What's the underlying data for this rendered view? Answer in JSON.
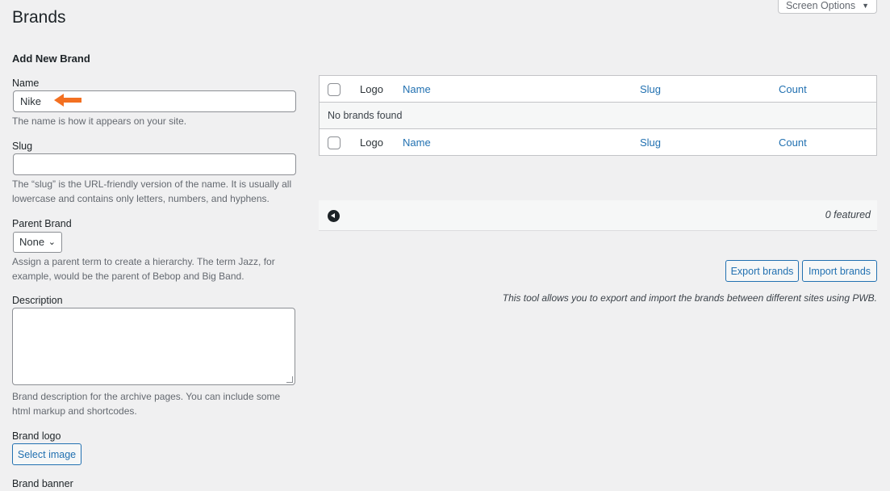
{
  "screen_options": {
    "label": "Screen Options"
  },
  "page": {
    "title": "Brands"
  },
  "form": {
    "title": "Add New Brand",
    "name": {
      "label": "Name",
      "value": "Nike",
      "help": "The name is how it appears on your site."
    },
    "slug": {
      "label": "Slug",
      "value": "",
      "help": "The “slug” is the URL-friendly version of the name. It is usually all lowercase and contains only letters, numbers, and hyphens."
    },
    "parent": {
      "label": "Parent Brand",
      "selected": "None",
      "help": "Assign a parent term to create a hierarchy. The term Jazz, for example, would be the parent of Bebop and Big Band."
    },
    "description": {
      "label": "Description",
      "help": "Brand description for the archive pages. You can include some html markup and shortcodes."
    },
    "logo": {
      "label": "Brand logo",
      "button": "Select image"
    },
    "banner": {
      "label": "Brand banner"
    }
  },
  "table": {
    "columns": [
      "Logo",
      "Name",
      "Slug",
      "Count"
    ],
    "empty": "No brands found"
  },
  "featured": {
    "text": "0 featured"
  },
  "tools": {
    "export": "Export brands",
    "import": "Import brands",
    "note": "This tool allows you to export and import the brands between different sites using PWB."
  },
  "colors": {
    "link": "#2271b1",
    "annotation_arrow": "#f37021"
  }
}
